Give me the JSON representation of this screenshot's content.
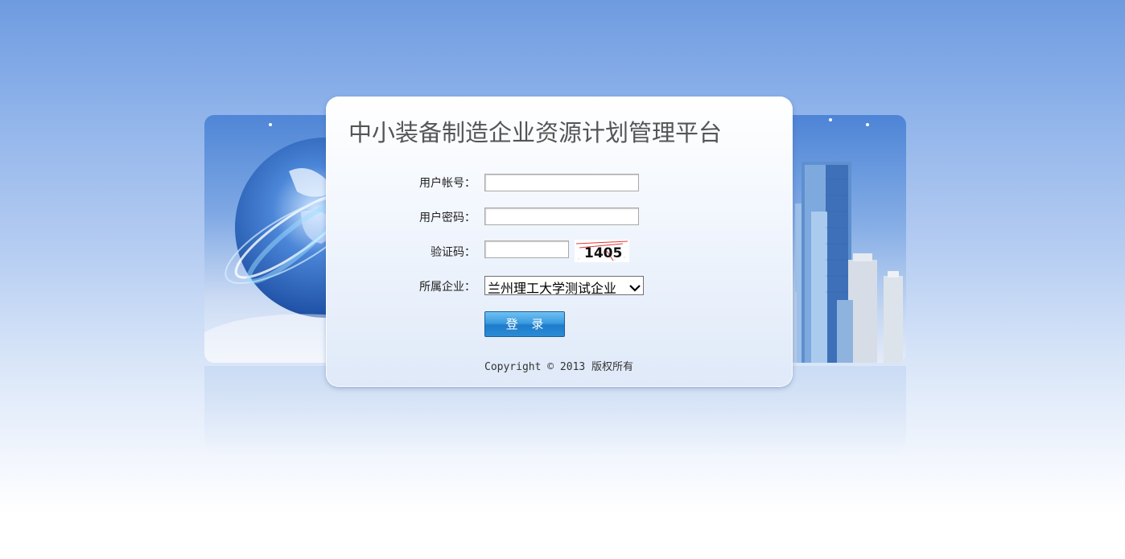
{
  "app": {
    "title": "中小装备制造企业资源计划管理平台"
  },
  "form": {
    "username_label": "用户帐号：",
    "username_value": "",
    "password_label": "用户密码：",
    "password_value": "",
    "captcha_label": "验证码：",
    "captcha_value": "",
    "captcha_image_text": "1405",
    "company_label": "所属企业：",
    "company_selected": "兰州理工大学测试企业",
    "login_button": "登 录"
  },
  "footer": {
    "copyright": "Copyright © 2013 版权所有"
  },
  "colors": {
    "background_top": "#6e9be0",
    "panel_bottom": "#dfe9f8",
    "button_blue": "#2a8bd6",
    "title_gray": "#555555"
  }
}
